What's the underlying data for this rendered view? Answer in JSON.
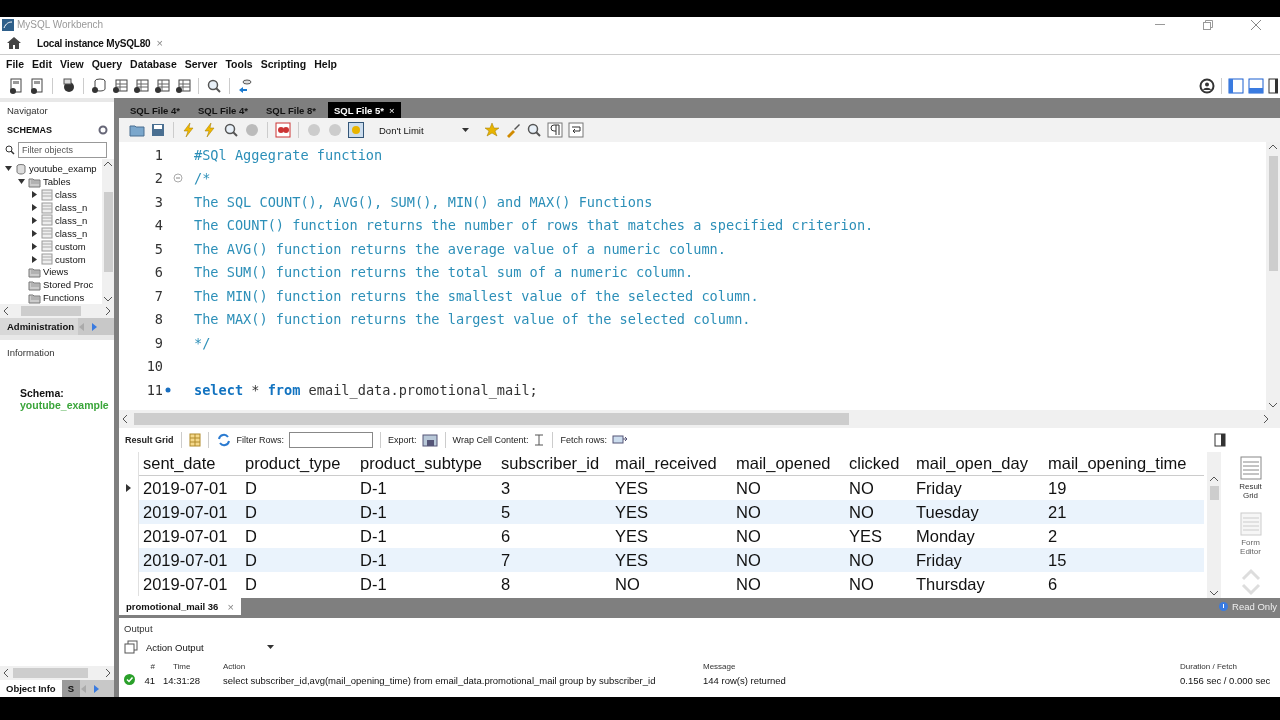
{
  "window": {
    "title": "MySQL Workbench"
  },
  "connection_tab": {
    "label": "Local instance MySQL80",
    "close": "×"
  },
  "menu": [
    "File",
    "Edit",
    "View",
    "Query",
    "Database",
    "Server",
    "Tools",
    "Scripting",
    "Help"
  ],
  "navigator": {
    "title": "Navigator",
    "section": "SCHEMAS",
    "filter": {
      "placeholder": "Filter objects"
    },
    "tree": [
      {
        "label": "youtube_examp",
        "kind": "schema",
        "expanded": true,
        "children": [
          {
            "label": "Tables",
            "kind": "folder",
            "expanded": true,
            "children": [
              {
                "label": "class",
                "kind": "table",
                "expanded": false
              },
              {
                "label": "class_n",
                "kind": "table",
                "expanded": false
              },
              {
                "label": "class_n",
                "kind": "table",
                "expanded": false
              },
              {
                "label": "class_n",
                "kind": "table",
                "expanded": false
              },
              {
                "label": "custom",
                "kind": "table",
                "expanded": false
              },
              {
                "label": "custom",
                "kind": "table",
                "expanded": false
              }
            ]
          },
          {
            "label": "Views",
            "kind": "folder"
          },
          {
            "label": "Stored Proc",
            "kind": "folder"
          },
          {
            "label": "Functions",
            "kind": "folder"
          }
        ]
      }
    ]
  },
  "admin_tab": {
    "label": "Administration"
  },
  "information": {
    "title": "Information",
    "label": "Schema:",
    "value": "youtube_example"
  },
  "bottom_tabs": [
    {
      "label": "Object Info",
      "selected": true
    },
    {
      "label": "S",
      "selected": false
    }
  ],
  "editor_tabs": [
    {
      "label": "SQL File 4*",
      "selected": false
    },
    {
      "label": "SQL File 4*",
      "selected": false
    },
    {
      "label": "SQL File 8*",
      "selected": false
    },
    {
      "label": "SQL File 5*",
      "selected": true,
      "close": "×"
    }
  ],
  "limit_select": {
    "value": "Don't Limit"
  },
  "code": [
    {
      "number": "1",
      "tokens": [
        {
          "kind": "comment",
          "text": "#SQl Aggegrate function"
        }
      ]
    },
    {
      "number": "2",
      "fold": true,
      "tokens": [
        {
          "kind": "comment",
          "text": "/*"
        }
      ]
    },
    {
      "number": "3",
      "tokens": [
        {
          "kind": "comment",
          "text": "The SQL COUNT(), AVG(), SUM(), MIN() and MAX() Functions"
        }
      ]
    },
    {
      "number": "4",
      "tokens": [
        {
          "kind": "comment",
          "text": "The COUNT() function returns the number of rows that matches a specified criterion."
        }
      ]
    },
    {
      "number": "5",
      "tokens": [
        {
          "kind": "comment",
          "text": "The AVG() function returns the average value of a numeric column."
        }
      ]
    },
    {
      "number": "6",
      "tokens": [
        {
          "kind": "comment",
          "text": "The SUM() function returns the total sum of a numeric column."
        }
      ]
    },
    {
      "number": "7",
      "tokens": [
        {
          "kind": "comment",
          "text": "The MIN() function returns the smallest value of the selected column."
        }
      ]
    },
    {
      "number": "8",
      "tokens": [
        {
          "kind": "comment",
          "text": "The MAX() function returns the largest value of the selected column."
        }
      ]
    },
    {
      "number": "9",
      "tokens": [
        {
          "kind": "comment",
          "text": "*/"
        }
      ]
    },
    {
      "number": "10"
    },
    {
      "number": "11",
      "statement": true,
      "tokens": [
        {
          "kind": "keyword",
          "text": "select"
        },
        {
          "kind": "plain",
          "text": " * "
        },
        {
          "kind": "keyword",
          "text": "from"
        },
        {
          "kind": "plain",
          "text": " email_data.promotional_mail;"
        }
      ]
    }
  ],
  "result_toolbar": {
    "result_grid": "Result Grid",
    "filter_label": "Filter Rows:",
    "export_label": "Export:",
    "wrap_label": "Wrap Cell Content:",
    "fetch_label": "Fetch rows:"
  },
  "table": {
    "columns": [
      "sent_date",
      "product_type",
      "product_subtype",
      "subscriber_id",
      "mail_received",
      "mail_opened",
      "clicked",
      "mail_open_day",
      "mail_opening_time"
    ],
    "rows": [
      {
        "current": true,
        "cells": [
          "2019-07-01",
          "D",
          "D-1",
          "3",
          "YES",
          "NO",
          "NO",
          "Friday",
          "19"
        ]
      },
      {
        "current": false,
        "cells": [
          "2019-07-01",
          "D",
          "D-1",
          "5",
          "YES",
          "NO",
          "NO",
          "Tuesday",
          "21"
        ]
      },
      {
        "current": false,
        "cells": [
          "2019-07-01",
          "D",
          "D-1",
          "6",
          "YES",
          "NO",
          "YES",
          "Monday",
          "2"
        ]
      },
      {
        "current": false,
        "cells": [
          "2019-07-01",
          "D",
          "D-1",
          "7",
          "YES",
          "NO",
          "NO",
          "Friday",
          "15"
        ]
      },
      {
        "current": false,
        "cells": [
          "2019-07-01",
          "D",
          "D-1",
          "8",
          "NO",
          "NO",
          "NO",
          "Thursday",
          "6"
        ]
      }
    ]
  },
  "side_buttons": [
    {
      "label": "Result Grid",
      "selected": true
    },
    {
      "label": "Form Editor",
      "selected": false
    }
  ],
  "result_tab": {
    "label": "promotional_mail 36",
    "close": "×"
  },
  "read_only": "Read Only",
  "output": {
    "title": "Output",
    "mode": "Action Output",
    "columns": [
      "#",
      "Time",
      "Action",
      "Message",
      "Duration / Fetch"
    ],
    "rows": [
      {
        "success": true,
        "number": "41",
        "time": "14:31:28",
        "action": "select subscriber_id,avg(mail_opening_time) from email_data.promotional_mail group by subscriber_id",
        "message": "144 row(s) returned",
        "duration": "0.156 sec / 0.000 sec"
      }
    ]
  }
}
